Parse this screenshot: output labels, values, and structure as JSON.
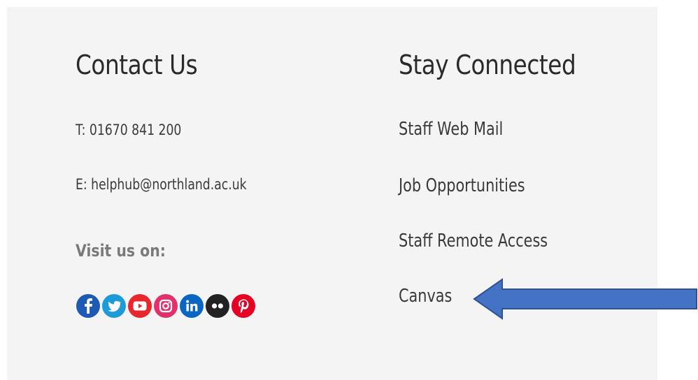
{
  "contact": {
    "heading": "Contact Us",
    "phone": "T: 01670 841 200",
    "email": "E: helphub@northland.ac.uk",
    "visit_label": "Visit us on:",
    "socials": [
      {
        "icon": "facebook-icon",
        "color": "#1d5ab4"
      },
      {
        "icon": "twitter-icon",
        "color": "#1d9bd8"
      },
      {
        "icon": "youtube-icon",
        "color": "#e8262c"
      },
      {
        "icon": "instagram-icon",
        "color": "#e1306c"
      },
      {
        "icon": "linkedin-icon",
        "color": "#0a66c2"
      },
      {
        "icon": "flickr-icon",
        "color": "#222222"
      },
      {
        "icon": "pinterest-icon",
        "color": "#e60023"
      }
    ]
  },
  "stay_connected": {
    "heading": "Stay Connected",
    "links": [
      {
        "label": "Staff Web Mail"
      },
      {
        "label": "Job Opportunities"
      },
      {
        "label": "Staff Remote Access"
      },
      {
        "label": "Canvas"
      }
    ]
  },
  "annotation": {
    "arrow_color": "#4472c4",
    "arrow_outline": "#2f528f",
    "arrow_direction": "left"
  }
}
